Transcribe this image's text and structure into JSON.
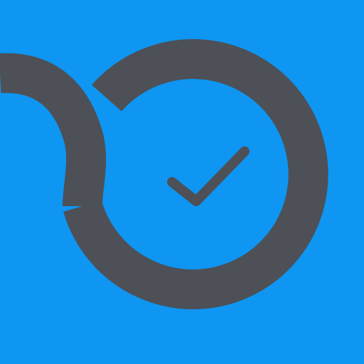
{
  "icon": {
    "name": "app-logo",
    "glyph": "loop-clock-check-icon",
    "colors": {
      "background": "#0E96F2",
      "stroke": "#4D5057"
    }
  }
}
